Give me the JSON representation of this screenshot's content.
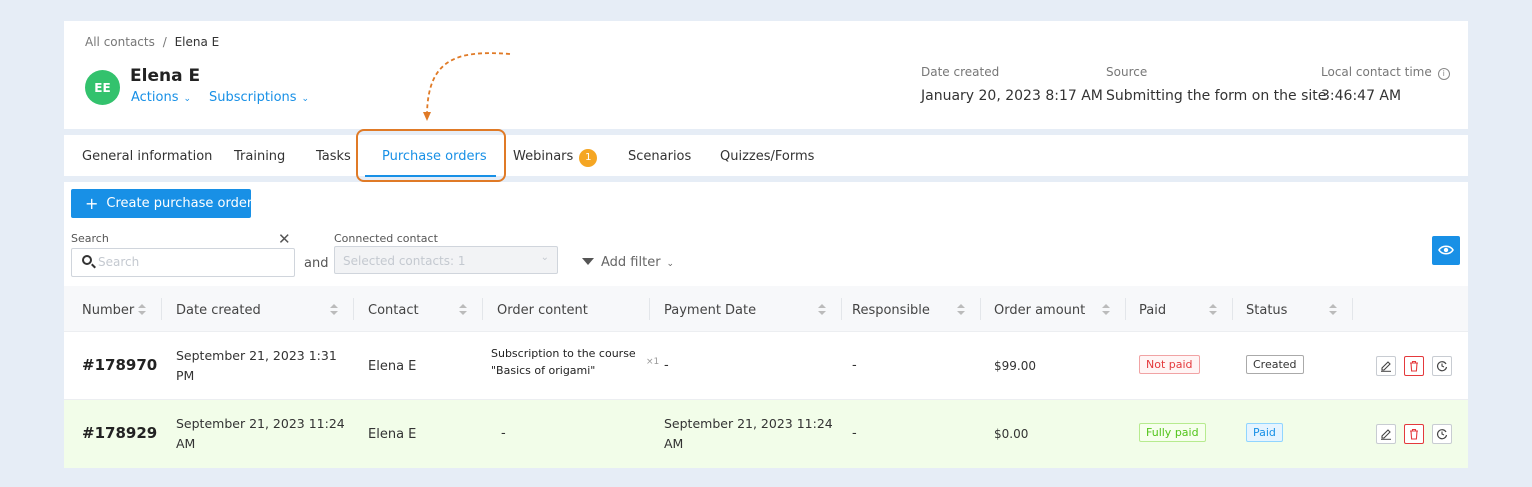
{
  "header": {
    "breadcrumb_root": "All contacts",
    "breadcrumb_sep": "/",
    "breadcrumb_current": "Elena E",
    "avatar_initials": "EE",
    "contact_name": "Elena E",
    "actions_label": "Actions",
    "subscriptions_label": "Subscriptions",
    "date_created_label": "Date created",
    "date_created_value": "January 20, 2023 8:17 AM",
    "source_label": "Source",
    "source_value": "Submitting the form on the site",
    "local_time_label": "Local contact time",
    "local_time_value": "3:46:47 AM"
  },
  "tabs": [
    {
      "label": "General information"
    },
    {
      "label": "Training"
    },
    {
      "label": "Tasks"
    },
    {
      "label": "Purchase orders",
      "active": true
    },
    {
      "label": "Webinars",
      "badge": "1"
    },
    {
      "label": "Scenarios"
    },
    {
      "label": "Quizzes/Forms"
    }
  ],
  "toolbar": {
    "create_label": "Create purchase order",
    "search_label": "Search",
    "search_placeholder": "Search",
    "search_value": "",
    "and_label": "and",
    "connected_label": "Connected contact",
    "connected_value": "Selected contacts: 1",
    "add_filter_label": "Add filter"
  },
  "table": {
    "columns": [
      "Number",
      "Date created",
      "Contact",
      "Order content",
      "Payment Date",
      "Responsible",
      "Order amount",
      "Paid",
      "Status"
    ],
    "rows": [
      {
        "number": "#178970",
        "date_line1": "September 21, 2023 1:31",
        "date_line2": "PM",
        "contact": "Elena E",
        "content_line1": "Subscription to the course",
        "content_line2": "\"Basics of origami\"",
        "qty": "×1",
        "payment_line1": "-",
        "payment_line2": "",
        "responsible": "-",
        "amount": "$99.00",
        "paid": "Not paid",
        "status": "Created"
      },
      {
        "number": "#178929",
        "date_line1": "September 21, 2023 11:24",
        "date_line2": "AM",
        "contact": "Elena E",
        "content": "-",
        "payment_line1": "September 21, 2023 11:24",
        "payment_line2": "AM",
        "responsible": "-",
        "amount": "$0.00",
        "paid": "Fully paid",
        "status": "Paid"
      }
    ]
  },
  "colors": {
    "accent": "#1890e6",
    "avatar": "#33c26d",
    "highlight": "#e07a26",
    "badge": "#f5a623",
    "paid_row_bg": "#f2fde9"
  },
  "icons": [
    "search-icon",
    "clear-icon",
    "funnel-icon",
    "eye-icon",
    "edit-icon",
    "delete-icon",
    "history-icon",
    "info-icon",
    "chevron-down-icon",
    "sort-icon",
    "plus-icon",
    "annotation-arrow"
  ]
}
